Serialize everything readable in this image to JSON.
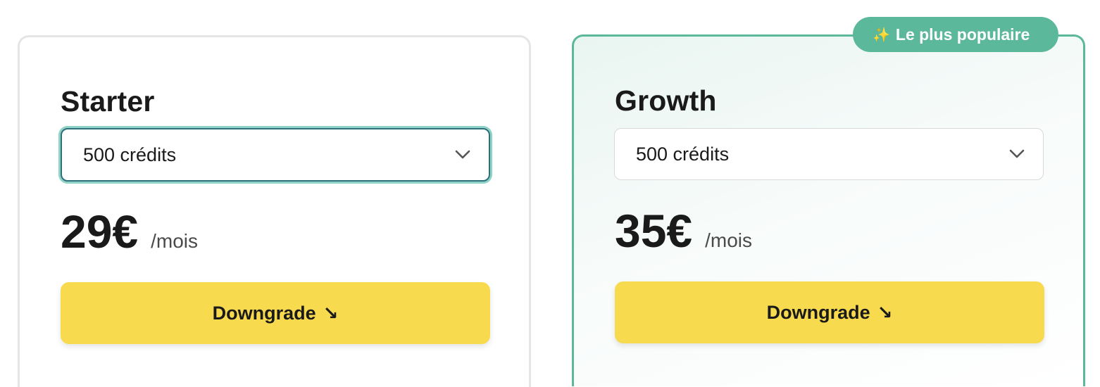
{
  "plans": [
    {
      "name": "Starter",
      "selected_option": "500 crédits",
      "price": "29€",
      "period": "/mois",
      "button_label": "Downgrade",
      "button_icon": "↘"
    },
    {
      "name": "Growth",
      "selected_option": "500 crédits",
      "price": "35€",
      "period": "/mois",
      "button_label": "Downgrade",
      "button_icon": "↘"
    }
  ],
  "badge": {
    "icon": "✨",
    "label": "Le plus populaire"
  },
  "colors": {
    "accent": "#5bb89a",
    "button": "#f8da4e",
    "text": "#1a1a1a"
  }
}
